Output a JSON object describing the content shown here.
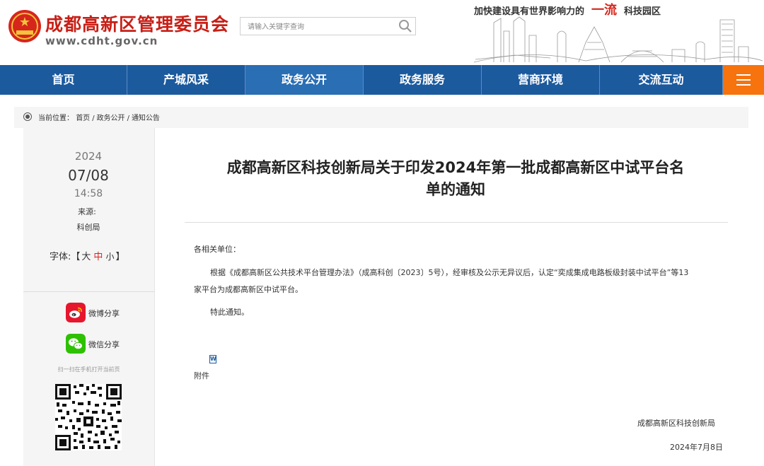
{
  "header": {
    "site_title": "成都高新区管理委员会",
    "site_url": "www.cdht.gov.cn",
    "search_placeholder": "请输入关键字查询",
    "slogan_left": "加快建设具有世界影响力的",
    "slogan_accent": "一流",
    "slogan_right": "科技园区"
  },
  "nav": {
    "items": [
      {
        "label": "首页"
      },
      {
        "label": "产城风采"
      },
      {
        "label": "政务公开"
      },
      {
        "label": "政务服务"
      },
      {
        "label": "营商环境"
      },
      {
        "label": "交流互动"
      }
    ],
    "active_index": 2
  },
  "breadcrumb": {
    "label": "当前位置：",
    "items": [
      "首页",
      "政务公开",
      "通知公告"
    ],
    "separator": "/"
  },
  "sidebar": {
    "year": "2024",
    "date": "07/08",
    "time": "14:58",
    "source_label": "来源:",
    "source_value": "科创局",
    "font_label": "字体:",
    "font_open": "【",
    "font_large": "大",
    "font_medium": "中",
    "font_small": "小",
    "font_close": "】",
    "weibo_label": "微博分享",
    "wechat_label": "微信分享",
    "qr_hint": "扫一扫在手机打开当前页"
  },
  "article": {
    "title_line1": "成都高新区科技创新局关于印发2024年第一批成都高新区中试平台名",
    "title_line2": "单的通知",
    "salutation": "各相关单位：",
    "body_line1": "根据《成都高新区公共技术平台管理办法》（成高科创〔2023〕5号），经审核及公示无异议后，认定“奕成集成电路板级封装中试平台”等13",
    "body_line2": "家平台为成都高新区中试平台。",
    "closing": "特此通知。",
    "attachment_label": "附件",
    "signature": "成都高新区科技创新局",
    "sign_date": "2024年7月8日"
  },
  "colors": {
    "brand_red": "#c71f16",
    "nav_blue": "#1c5a9e",
    "nav_active": "#2a6eb4",
    "menu_orange": "#f7730e",
    "weibo": "#e6162d",
    "wechat": "#2dc100"
  }
}
